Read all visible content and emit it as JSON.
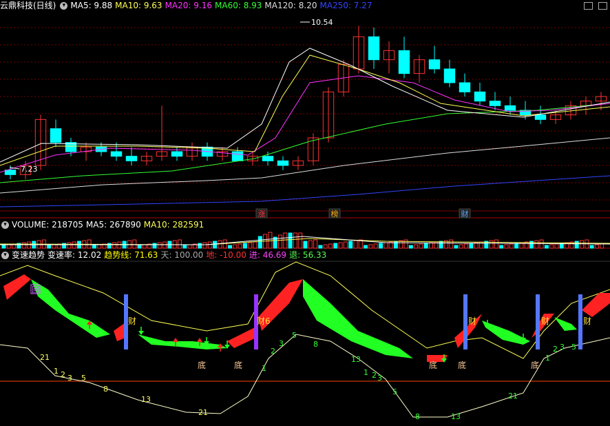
{
  "main_header": {
    "title": "云鼎科技(日线)",
    "ma_labels": [
      "MA5: 9.88",
      "MA10: 9.63",
      "MA20: 9.16",
      "MA60: 8.93",
      "MA120: 8.20",
      "MA250: 7.27"
    ],
    "ma_colors": [
      "#ffffff",
      "#ffff55",
      "#ff33ff",
      "#33ff33",
      "#dddddd",
      "#3344ff"
    ]
  },
  "volume_header": {
    "labels": [
      "VOLUME: 218705",
      "MA5: 267890",
      "MA10: 282591"
    ],
    "colors": [
      "#ffffff",
      "#ffffff",
      "#ffff55"
    ]
  },
  "indicator_header": {
    "labels": [
      "变速趋势",
      "变速率: 12.02",
      "趋势线: 71.63",
      "天: 100.00",
      "地: -10.00",
      "进: 46.69",
      "退: 56.33"
    ],
    "colors": [
      "#ffffff",
      "#ffffff",
      "#ffff00",
      "#aaaaaa",
      "#ff3333",
      "#ff44ff",
      "#55ff55"
    ]
  },
  "chart_data": [
    {
      "type": "candlestick",
      "name": "云鼎科技(日线)",
      "price_annotations": [
        {
          "label": "10.54",
          "kind": "high"
        },
        {
          "label": "7.23",
          "kind": "low"
        }
      ],
      "ohlc_sampled": [
        [
          7.4,
          7.5,
          7.2,
          7.3
        ],
        [
          7.3,
          7.6,
          7.2,
          7.5
        ],
        [
          7.5,
          8.6,
          7.4,
          8.5
        ],
        [
          8.3,
          8.5,
          7.9,
          8.0
        ],
        [
          8.0,
          8.1,
          7.7,
          7.8
        ],
        [
          7.8,
          8.0,
          7.6,
          7.9
        ],
        [
          7.9,
          8.0,
          7.7,
          7.8
        ],
        [
          7.8,
          8.0,
          7.6,
          7.7
        ],
        [
          7.7,
          7.9,
          7.5,
          7.6
        ],
        [
          7.6,
          7.8,
          7.5,
          7.7
        ],
        [
          7.7,
          8.8,
          7.6,
          7.8
        ],
        [
          7.8,
          7.9,
          7.6,
          7.7
        ],
        [
          7.7,
          8.0,
          7.6,
          7.9
        ],
        [
          7.9,
          8.0,
          7.6,
          7.7
        ],
        [
          7.7,
          7.9,
          7.6,
          7.8
        ],
        [
          7.8,
          7.9,
          7.6,
          7.6
        ],
        [
          7.6,
          7.8,
          7.5,
          7.7
        ],
        [
          7.7,
          7.8,
          7.5,
          7.6
        ],
        [
          7.6,
          7.7,
          7.4,
          7.5
        ],
        [
          7.5,
          7.7,
          7.4,
          7.6
        ],
        [
          7.6,
          8.2,
          7.5,
          8.1
        ],
        [
          8.1,
          9.2,
          8.0,
          9.1
        ],
        [
          9.1,
          9.8,
          9.0,
          9.7
        ],
        [
          9.6,
          10.54,
          9.5,
          10.3
        ],
        [
          10.3,
          10.5,
          9.6,
          9.8
        ],
        [
          9.8,
          10.2,
          9.5,
          10.0
        ],
        [
          10.0,
          10.3,
          9.4,
          9.5
        ],
        [
          9.5,
          9.9,
          9.3,
          9.8
        ],
        [
          9.8,
          10.1,
          9.5,
          9.6
        ],
        [
          9.6,
          9.8,
          9.2,
          9.3
        ],
        [
          9.3,
          9.5,
          9.0,
          9.1
        ],
        [
          9.1,
          9.3,
          8.8,
          8.9
        ],
        [
          8.9,
          9.1,
          8.7,
          8.8
        ],
        [
          8.8,
          9.0,
          8.6,
          8.7
        ],
        [
          8.7,
          8.9,
          8.5,
          8.6
        ],
        [
          8.6,
          8.8,
          8.4,
          8.5
        ],
        [
          8.5,
          8.7,
          8.4,
          8.6
        ],
        [
          8.6,
          8.9,
          8.5,
          8.8
        ],
        [
          8.8,
          9.0,
          8.6,
          8.9
        ],
        [
          8.9,
          9.1,
          8.7,
          9.0
        ]
      ],
      "moving_averages": [
        {
          "name": "MA5",
          "value": 9.88
        },
        {
          "name": "MA10",
          "value": 9.63
        },
        {
          "name": "MA20",
          "value": 9.16
        },
        {
          "name": "MA60",
          "value": 8.93
        },
        {
          "name": "MA120",
          "value": 8.2
        },
        {
          "name": "MA250",
          "value": 7.27
        }
      ],
      "markers": [
        {
          "label": "涨",
          "color": "#ff3333"
        },
        {
          "label": "榜",
          "color": "#ffaa00"
        },
        {
          "label": "财",
          "color": "#55aaff"
        }
      ]
    },
    {
      "type": "bar",
      "name": "VOLUME",
      "values": [
        218705
      ],
      "ma5": 267890,
      "ma10": 282591
    },
    {
      "type": "area",
      "name": "变速趋势",
      "values": {
        "变速率": 12.02,
        "趋势线": 71.63,
        "天": 100.0,
        "地": -10.0,
        "进": 46.69,
        "退": 56.33
      },
      "labels": {
        "caifu": "财",
        "caifu_mid": "财6",
        "bottom": "底",
        "hui": "回",
        "counts": [
          "21",
          "1",
          "2",
          "3",
          "5",
          "8",
          "13",
          "21",
          "1",
          "2",
          "3",
          "5",
          "8",
          "13",
          "1",
          "2",
          "3",
          "5",
          "8",
          "13",
          "21",
          "1",
          "2",
          "3",
          "5"
        ]
      }
    }
  ]
}
